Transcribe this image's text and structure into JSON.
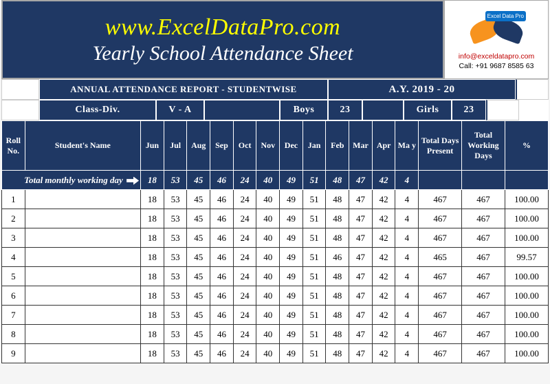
{
  "header": {
    "site_url": "www.ExcelDataPro.com",
    "title": "Yearly School Attendance Sheet",
    "contact_email": "info@exceldatapro.com",
    "contact_phone": "Call: +91 9687 8585 63",
    "logo_badge": "Excel\nData\nPro"
  },
  "meta": {
    "report_title": "ANNUAL ATTENDANCE REPORT - STUDENTWISE",
    "ay_label": "A.Y. 2019 - 20",
    "class_label": "Class-Div.",
    "class_value": "V - A",
    "boys_label": "Boys",
    "boys_value": "23",
    "girls_label": "Girls",
    "girls_value": "23"
  },
  "columns": {
    "roll": "Roll No.",
    "name": "Student's Name",
    "months": [
      "Jun",
      "Jul",
      "Aug",
      "Sep",
      "Oct",
      "Nov",
      "Dec",
      "Jan",
      "Feb",
      "Mar",
      "Apr",
      "Ma y"
    ],
    "tdp": "Total Days Present",
    "twd": "Total Working Days",
    "pct": "%"
  },
  "totals_row": {
    "label": "Total monthly working day",
    "values": [
      "18",
      "53",
      "45",
      "46",
      "24",
      "40",
      "49",
      "51",
      "48",
      "47",
      "42",
      "4"
    ],
    "tdp": "",
    "twd": "",
    "pct": ""
  },
  "rows": [
    {
      "roll": "1",
      "name": "",
      "m": [
        "18",
        "53",
        "45",
        "46",
        "24",
        "40",
        "49",
        "51",
        "48",
        "47",
        "42",
        "4"
      ],
      "tdp": "467",
      "twd": "467",
      "pct": "100.00"
    },
    {
      "roll": "2",
      "name": "",
      "m": [
        "18",
        "53",
        "45",
        "46",
        "24",
        "40",
        "49",
        "51",
        "48",
        "47",
        "42",
        "4"
      ],
      "tdp": "467",
      "twd": "467",
      "pct": "100.00"
    },
    {
      "roll": "3",
      "name": "",
      "m": [
        "18",
        "53",
        "45",
        "46",
        "24",
        "40",
        "49",
        "51",
        "48",
        "47",
        "42",
        "4"
      ],
      "tdp": "467",
      "twd": "467",
      "pct": "100.00"
    },
    {
      "roll": "4",
      "name": "",
      "m": [
        "18",
        "53",
        "45",
        "46",
        "24",
        "40",
        "49",
        "51",
        "46",
        "47",
        "42",
        "4"
      ],
      "tdp": "465",
      "twd": "467",
      "pct": "99.57"
    },
    {
      "roll": "5",
      "name": "",
      "m": [
        "18",
        "53",
        "45",
        "46",
        "24",
        "40",
        "49",
        "51",
        "48",
        "47",
        "42",
        "4"
      ],
      "tdp": "467",
      "twd": "467",
      "pct": "100.00"
    },
    {
      "roll": "6",
      "name": "",
      "m": [
        "18",
        "53",
        "45",
        "46",
        "24",
        "40",
        "49",
        "51",
        "48",
        "47",
        "42",
        "4"
      ],
      "tdp": "467",
      "twd": "467",
      "pct": "100.00"
    },
    {
      "roll": "7",
      "name": "",
      "m": [
        "18",
        "53",
        "45",
        "46",
        "24",
        "40",
        "49",
        "51",
        "48",
        "47",
        "42",
        "4"
      ],
      "tdp": "467",
      "twd": "467",
      "pct": "100.00"
    },
    {
      "roll": "8",
      "name": "",
      "m": [
        "18",
        "53",
        "45",
        "46",
        "24",
        "40",
        "49",
        "51",
        "48",
        "47",
        "42",
        "4"
      ],
      "tdp": "467",
      "twd": "467",
      "pct": "100.00"
    },
    {
      "roll": "9",
      "name": "",
      "m": [
        "18",
        "53",
        "45",
        "46",
        "24",
        "40",
        "49",
        "51",
        "48",
        "47",
        "42",
        "4"
      ],
      "tdp": "467",
      "twd": "467",
      "pct": "100.00"
    }
  ]
}
